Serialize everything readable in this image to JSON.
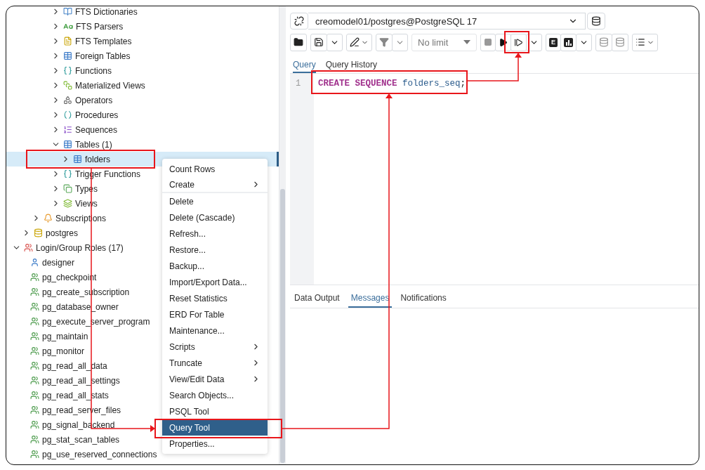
{
  "schema_objects": [
    {
      "label": "FTS Dictionaries",
      "expanded": false,
      "selected": false
    },
    {
      "label": "FTS Parsers",
      "expanded": false,
      "selected": false
    },
    {
      "label": "FTS Templates",
      "expanded": false,
      "selected": false
    },
    {
      "label": "Foreign Tables",
      "expanded": false,
      "selected": false
    },
    {
      "label": "Functions",
      "expanded": false,
      "selected": false
    },
    {
      "label": "Materialized Views",
      "expanded": false,
      "selected": false
    },
    {
      "label": "Operators",
      "expanded": false,
      "selected": false
    },
    {
      "label": "Procedures",
      "expanded": false,
      "selected": false
    },
    {
      "label": "Sequences",
      "expanded": false,
      "selected": false
    },
    {
      "label": "Tables (1)",
      "expanded": true,
      "selected": false,
      "children": [
        {
          "label": "folders",
          "expanded": false,
          "selected": true
        }
      ]
    },
    {
      "label": "Trigger Functions",
      "expanded": false,
      "selected": false
    },
    {
      "label": "Types",
      "expanded": false,
      "selected": false
    },
    {
      "label": "Views",
      "expanded": false,
      "selected": false
    }
  ],
  "database_objects": [
    {
      "label": "Subscriptions",
      "expanded": false,
      "selected": false
    }
  ],
  "databases": [
    {
      "label": "postgres",
      "expanded": false,
      "selected": false
    }
  ],
  "roles": {
    "label": "Login/Group Roles (17)",
    "expanded": true,
    "selected": false,
    "children": [
      {
        "label": "designer",
        "kind": "user",
        "selected": false
      },
      {
        "label": "pg_checkpoint",
        "kind": "group",
        "selected": false
      },
      {
        "label": "pg_create_subscription",
        "kind": "group",
        "selected": false
      },
      {
        "label": "pg_database_owner",
        "kind": "group",
        "selected": false
      },
      {
        "label": "pg_execute_server_program",
        "kind": "group",
        "selected": false
      },
      {
        "label": "pg_maintain",
        "kind": "group",
        "selected": false
      },
      {
        "label": "pg_monitor",
        "kind": "group",
        "selected": false
      },
      {
        "label": "pg_read_all_data",
        "kind": "group",
        "selected": false
      },
      {
        "label": "pg_read_all_settings",
        "kind": "group",
        "selected": false
      },
      {
        "label": "pg_read_all_stats",
        "kind": "group",
        "selected": false
      },
      {
        "label": "pg_read_server_files",
        "kind": "group",
        "selected": false
      },
      {
        "label": "pg_signal_backend",
        "kind": "group",
        "selected": false
      },
      {
        "label": "pg_stat_scan_tables",
        "kind": "group",
        "selected": false
      },
      {
        "label": "pg_use_reserved_connections",
        "kind": "group",
        "selected": false
      }
    ]
  },
  "context_menu": [
    {
      "label": "Count Rows",
      "submenu": false,
      "selected": false,
      "divider_after": false
    },
    {
      "label": "Create",
      "submenu": true,
      "selected": false,
      "divider_after": true
    },
    {
      "label": "Delete",
      "submenu": false,
      "selected": false,
      "divider_after": false
    },
    {
      "label": "Delete (Cascade)",
      "submenu": false,
      "selected": false,
      "divider_after": false
    },
    {
      "label": "Refresh...",
      "submenu": false,
      "selected": false,
      "divider_after": false
    },
    {
      "label": "Restore...",
      "submenu": false,
      "selected": false,
      "divider_after": false
    },
    {
      "label": "Backup...",
      "submenu": false,
      "selected": false,
      "divider_after": false
    },
    {
      "label": "Import/Export Data...",
      "submenu": false,
      "selected": false,
      "divider_after": false
    },
    {
      "label": "Reset Statistics",
      "submenu": false,
      "selected": false,
      "divider_after": false
    },
    {
      "label": "ERD For Table",
      "submenu": false,
      "selected": false,
      "divider_after": false
    },
    {
      "label": "Maintenance...",
      "submenu": false,
      "selected": false,
      "divider_after": false
    },
    {
      "label": "Scripts",
      "submenu": true,
      "selected": false,
      "divider_after": false
    },
    {
      "label": "Truncate",
      "submenu": true,
      "selected": false,
      "divider_after": false
    },
    {
      "label": "View/Edit Data",
      "submenu": true,
      "selected": false,
      "divider_after": false
    },
    {
      "label": "Search Objects...",
      "submenu": false,
      "selected": false,
      "divider_after": false
    },
    {
      "label": "PSQL Tool",
      "submenu": false,
      "selected": false,
      "divider_after": false
    },
    {
      "label": "Query Tool",
      "submenu": false,
      "selected": true,
      "divider_after": false
    },
    {
      "label": "Properties...",
      "submenu": false,
      "selected": false,
      "divider_after": false
    }
  ],
  "connection": "creomodel01/postgres@PostgreSQL 17",
  "toolbar": {
    "limit": "No limit",
    "explain_label": "E"
  },
  "editor_tabs": [
    {
      "label": "Query",
      "selected": true
    },
    {
      "label": "Query History",
      "selected": false
    }
  ],
  "editor": {
    "line_number": "1",
    "tokens": [
      {
        "text": "CREATE",
        "kind": "keyword"
      },
      {
        "text": "SEQUENCE",
        "kind": "keyword"
      },
      {
        "text": "folders_seq",
        "kind": "identifier"
      },
      {
        "text": ";",
        "kind": "punctuation"
      }
    ]
  },
  "output_tabs": [
    {
      "label": "Data Output",
      "selected": false
    },
    {
      "label": "Messages",
      "selected": true
    },
    {
      "label": "Notifications",
      "selected": false
    }
  ]
}
